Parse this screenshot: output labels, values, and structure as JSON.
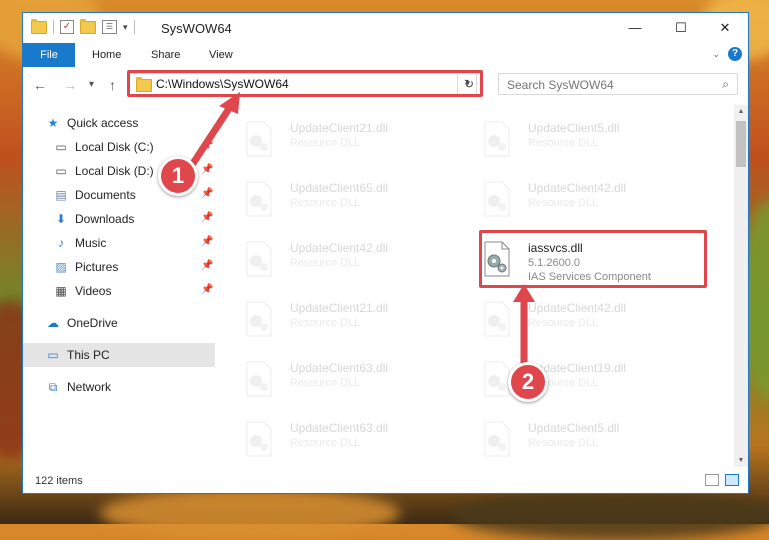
{
  "window": {
    "title": "SysWOW64",
    "controls": {
      "minimize": "—",
      "maximize": "☐",
      "close": "✕"
    }
  },
  "ribbon": {
    "file_tab": "File",
    "tabs": [
      "Home",
      "Share",
      "View"
    ]
  },
  "nav": {
    "back": "←",
    "forward": "→",
    "recent": "▾",
    "up": "↑",
    "address": "C:\\Windows\\SysWOW64",
    "refresh": "↻",
    "search_placeholder": "Search SysWOW64"
  },
  "sidebar": {
    "items": [
      {
        "label": "Quick access",
        "icon": "★"
      },
      {
        "label": "Local Disk (C:)",
        "icon": "▭"
      },
      {
        "label": "Local Disk (D:)",
        "icon": "▭"
      },
      {
        "label": "Documents",
        "icon": "▤"
      },
      {
        "label": "Downloads",
        "icon": "⬇"
      },
      {
        "label": "Music",
        "icon": "♪"
      },
      {
        "label": "Pictures",
        "icon": "▨"
      },
      {
        "label": "Videos",
        "icon": "▦"
      },
      {
        "label": "OneDrive",
        "icon": "☁"
      },
      {
        "label": "This PC",
        "icon": "▭"
      },
      {
        "label": "Network",
        "icon": "⧉"
      }
    ]
  },
  "files": {
    "col1": [
      {
        "name": "UpdateClient21.dll",
        "type": "Resource DLL"
      },
      {
        "name": "UpdateClient65.dll",
        "type": "Resource DLL"
      },
      {
        "name": "UpdateClient42.dll",
        "type": "Resource DLL"
      },
      {
        "name": "UpdateClient21.dll",
        "type": "Resource DLL"
      },
      {
        "name": "UpdateClient63.dll",
        "type": "Resource DLL"
      },
      {
        "name": "UpdateClient63.dll",
        "type": "Resource DLL"
      }
    ],
    "col2": [
      {
        "name": "UpdateClient5.dll",
        "type": "Resource DLL"
      },
      {
        "name": "UpdateClient42.dll",
        "type": "Resource DLL"
      },
      {
        "name": "iassvcs.dll",
        "version": "5.1.2600.0",
        "type": "IAS Services Component"
      },
      {
        "name": "UpdateClient42.dll",
        "type": "Resource DLL"
      },
      {
        "name": "UpdateClient19.dll",
        "type": "Resource DLL"
      },
      {
        "name": "UpdateClient5.dll",
        "type": "Resource DLL"
      }
    ]
  },
  "status": {
    "count": "122 items"
  },
  "annotations": {
    "step1": "1",
    "step2": "2",
    "color": "#e0474c"
  }
}
